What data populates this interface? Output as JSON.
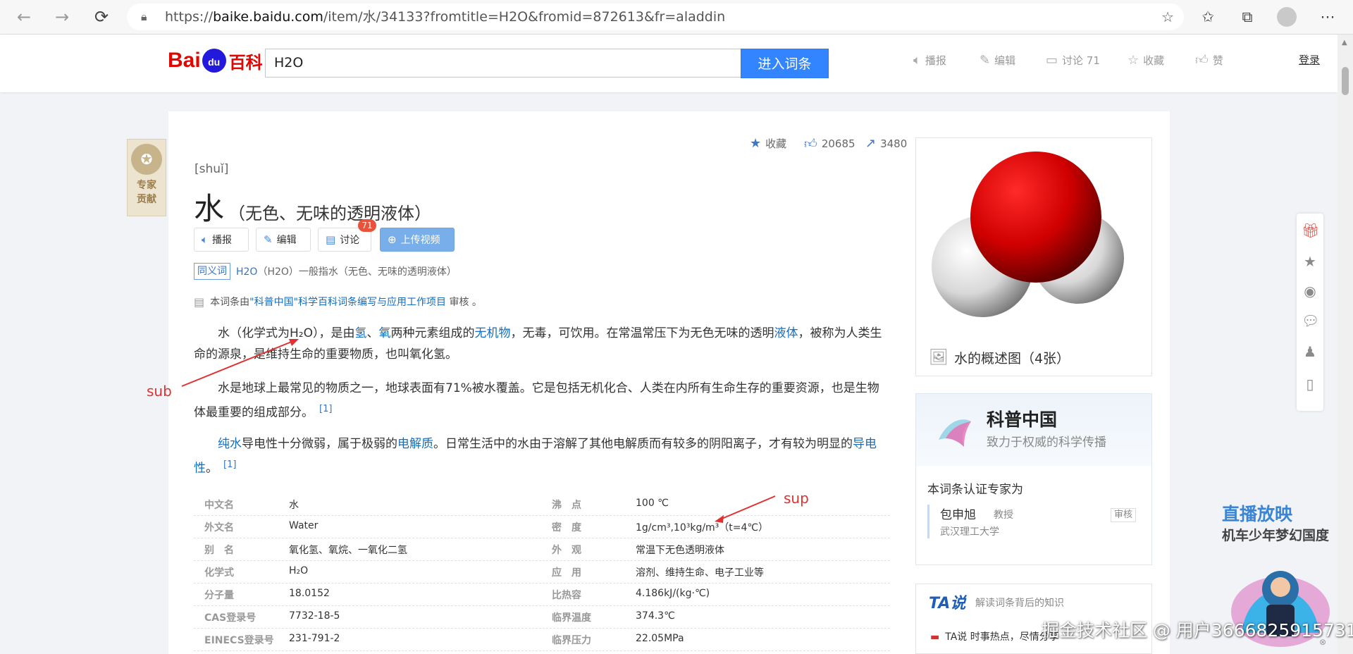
{
  "browser": {
    "url_prefix": "https://",
    "url_host": "baike.baidu.com",
    "url_path": "/item/水/34133?fromtitle=H2O&fromid=872613&fr=aladdin"
  },
  "header": {
    "logo_text_bai": "Bai",
    "logo_text_du": "du",
    "logo_text_baike": "百科",
    "search_value": "H2O",
    "search_button": "进入词条",
    "actions": {
      "broadcast": "播报",
      "edit": "编辑",
      "discuss": "讨论 71",
      "collect": "收藏",
      "like": "赞"
    },
    "login": "登录"
  },
  "expert_badge": {
    "line1": "专家",
    "line2": "贡献"
  },
  "stats": {
    "collect": "收藏",
    "likes": "20685",
    "shares": "3480"
  },
  "entry": {
    "pinyin": "[shuǐ]",
    "title": "水",
    "subtitle": "（无色、无味的透明液体）",
    "buttons": {
      "broadcast": "播报",
      "edit": "编辑",
      "discuss": "讨论",
      "discuss_count": "71",
      "upload": "上传视频"
    },
    "synonym_tag": "同义词",
    "synonym_link": "H2O",
    "synonym_rest": "（H2O）一般指水（无色、无味的透明液体）",
    "review_pre": "本词条由",
    "review_link": "\"科普中国\"科学百科词条编写与应用工作项目",
    "review_post": " 审核 。"
  },
  "paragraphs": {
    "p1_a": "水（化学式为H₂O），是由",
    "p1_link1": "氢",
    "p1_b": "、",
    "p1_link2": "氧",
    "p1_c": "两种元素组成的",
    "p1_link3": "无机物",
    "p1_d": "，无毒，可饮用。在常温常压下为无色无味的透明",
    "p1_link4": "液体",
    "p1_e": "，被称为人类生命的源泉，是维持生命的重要物质，也叫氧化氢。",
    "p2": "水是地球上最常见的物质之一，地球表面有71%被水覆盖。它是包括无机化合、人类在内所有生命生存的重要资源，也是生物体最重要的组成部分。",
    "p2_ref": "[1]",
    "p3_link1": "纯水",
    "p3_a": "导电性十分微弱，属于极弱的",
    "p3_link2": "电解质",
    "p3_b": "。日常生活中的水由于溶解了其他电解质而有较多的阴阳离子，才有较为明显的",
    "p3_link3": "导电性",
    "p3_c": "。",
    "p3_ref": "[1]"
  },
  "info_table": [
    {
      "k1": "中文名",
      "v1": "水",
      "k2": "沸　点",
      "v2": "100 ℃"
    },
    {
      "k1": "外文名",
      "v1": "Water",
      "k2": "密　度",
      "v2": "1g/cm³,10³kg/m³（t=4℃）"
    },
    {
      "k1": "别　名",
      "v1": "氧化氢、氧烷、一氧化二氢",
      "k2": "外　观",
      "v2": "常温下无色透明液体"
    },
    {
      "k1": "化学式",
      "v1": "H₂O",
      "k2": "应　用",
      "v2": "溶剂、维持生命、电子工业等"
    },
    {
      "k1": "分子量",
      "v1": "18.0152",
      "k2": "比热容",
      "v2": "4.186kJ/(kg·℃)"
    },
    {
      "k1": "CAS登录号",
      "v1": "7732-18-5",
      "k2": "临界温度",
      "v2": "374.3℃"
    },
    {
      "k1": "EINECS登录号",
      "v1": "231-791-2",
      "k2": "临界压力",
      "v2": "22.05MPa"
    }
  ],
  "image": {
    "caption": "水的概述图（4张）"
  },
  "kepu": {
    "title": "科普中国",
    "subtitle": "致力于权威的科学传播",
    "expert_label": "本词条认证专家为",
    "expert_name": "包申旭",
    "expert_rank": "教授",
    "expert_org": "武汉理工大学",
    "review": "审核"
  },
  "ta": {
    "logo": "TA说",
    "desc": "解读词条背后的知识",
    "item": "TA说  时事热点，尽情分享"
  },
  "live_ad": {
    "title": "直播放映",
    "subtitle": "机车少年梦幻国度"
  },
  "watermark": "掘金技术社区 @ 用户3666825915731",
  "annotations": {
    "sub": "sub",
    "sup": "sup"
  },
  "colors": {
    "accent": "#3385ff",
    "link": "#136ec2",
    "brand_red": "#e10602",
    "annotation": "#e03030"
  }
}
